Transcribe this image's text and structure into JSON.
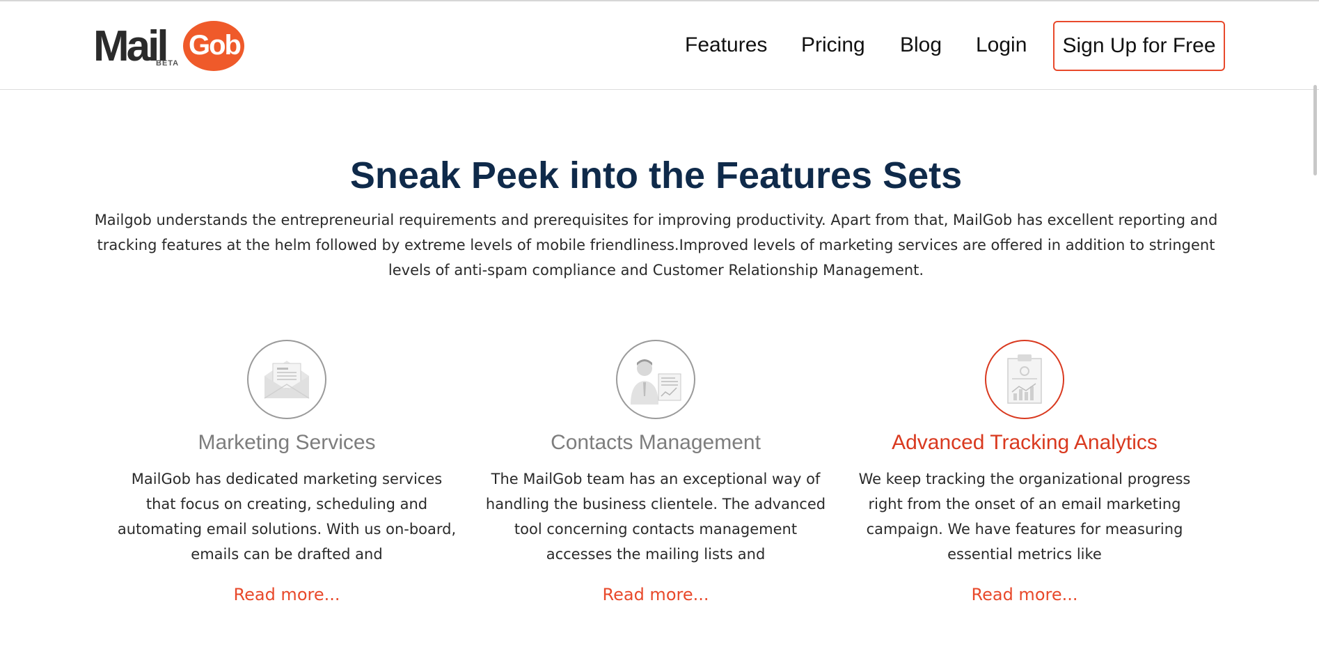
{
  "brand": {
    "logo_part1": "Mail",
    "logo_part2": "Gob",
    "logo_badge": "BETA",
    "accent_color": "#ef5a2a",
    "title_color": "#0f2a4a"
  },
  "nav": {
    "links": [
      "Features",
      "Pricing",
      "Blog",
      "Login"
    ],
    "cta": "Sign Up for Free"
  },
  "section": {
    "title": "Sneak Peek into the Features Sets",
    "description": "Mailgob understands the entrepreneurial requirements and prerequisites for improving productivity. Apart from that, MailGob has excellent reporting and tracking features at the helm followed by extreme levels of mobile friendliness.Improved levels of marketing services are offered in addition to stringent levels of anti-spam compliance and Customer Relationship Management."
  },
  "features": [
    {
      "icon": "envelope-letter-icon",
      "title": "Marketing Services",
      "text": "MailGob has dedicated marketing services that focus on creating, scheduling and automating email solutions. With us on-board, emails can be drafted and",
      "read_more": "Read more...",
      "active": false
    },
    {
      "icon": "contact-person-card-icon",
      "title": "Contacts Management",
      "text": "The MailGob team has an exceptional way of handling the business clientele. The advanced tool concerning contacts management accesses the mailing lists and",
      "read_more": "Read more...",
      "active": false
    },
    {
      "icon": "clipboard-chart-icon",
      "title": "Advanced Tracking Analytics",
      "text": "We keep tracking the organizational progress right from the onset of an email marketing campaign. We have features for measuring essential metrics like",
      "read_more": "Read more...",
      "active": true
    }
  ]
}
